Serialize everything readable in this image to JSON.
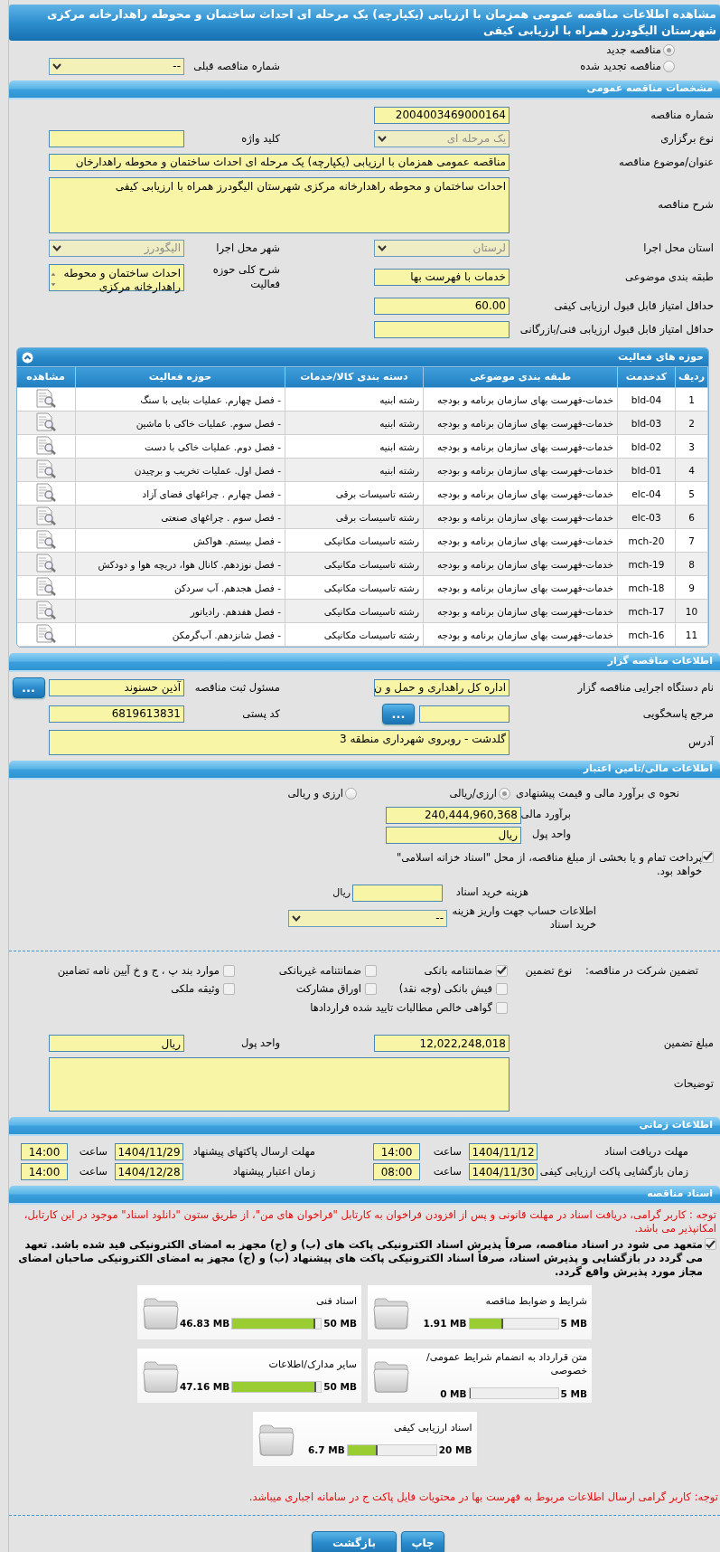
{
  "title": "مشاهده اطلاعات مناقصه عمومی همزمان با ارزیابی (یکپارچه) یک مرحله ای احداث ساختمان و محوطه راهدارخانه مرکزی شهرستان الیگودرز همراه با ارزیابی کیفی",
  "tender_kind": [
    {
      "label": "مناقصه جدید",
      "selected": true
    },
    {
      "label": "مناقصه تجدید شده",
      "selected": false
    }
  ],
  "previous_tender": {
    "label": "شماره مناقصه قبلی",
    "kind": "select",
    "value": "--",
    "disabled": false
  },
  "general": {
    "header": "مشخصات مناقصه عمومی",
    "rows": [
      [
        {
          "label": "شماره مناقصه",
          "kind": "text",
          "value": "2004003469000164"
        }
      ],
      [
        {
          "label": "نوع برگزاری",
          "kind": "select",
          "value": "یک مرحله ای",
          "disabled": true
        },
        {
          "label": "کلید واژه",
          "kind": "text"
        }
      ],
      [
        {
          "label": "عنوان/موضوع مناقصه",
          "kind": "line",
          "value": "مناقصه عمومی همزمان با ارزیابی (یکپارچه) یک مرحله ای احداث ساختمان و محوطه راهدارخان"
        }
      ],
      [
        {
          "label": "شرح مناقصه",
          "kind": "memo",
          "value": "احداث ساختمان و محوطه راهدارخانه مرکزی شهرستان الیگودرز همراه با ارزیابی کیفی"
        }
      ],
      [
        {
          "label": "استان محل اجرا",
          "kind": "select",
          "value": "لرستان",
          "disabled": true
        },
        {
          "label": "شهر محل اجرا",
          "kind": "select",
          "value": "الیگودرز",
          "disabled": true
        }
      ],
      [
        {
          "label": "طبقه بندی موضوعی",
          "kind": "text",
          "value": "خدمات با فهرست بها"
        },
        {
          "label": "شرح کلی حوزه فعالیت",
          "kind": "listbox",
          "value": "احداث ساختمان و محوطه راهدارخانه مرکزی"
        }
      ],
      [
        {
          "label": "حداقل امتیاز قابل قبول ارزیابی کیفی",
          "kind": "text",
          "value": "60.00"
        }
      ],
      [
        {
          "label": "حداقل امتیاز قابل قبول ارزیابی فنی/بازرگانی",
          "kind": "text"
        }
      ]
    ]
  },
  "activities": {
    "header": "حوزه های فعالیت",
    "columns": [
      "ردیف",
      "کدخدمت",
      "طبقه بندی موضوعی",
      "دسته بندی کالا/خدمات",
      "حوزه فعالیت",
      "مشاهده"
    ],
    "rows": [
      {
        "row": "1",
        "code": "bld-04",
        "classification": "خدمات-فهرست بهای سازمان برنامه و بودجه",
        "category": "رشته ابنیه",
        "activity": "- فصل چهارم. عملیات بنایی با سنگ"
      },
      {
        "row": "2",
        "code": "bld-03",
        "classification": "خدمات-فهرست بهای سازمان برنامه و بودجه",
        "category": "رشته ابنیه",
        "activity": "- فصل سوم. عملیات خاکی با ماشین"
      },
      {
        "row": "3",
        "code": "bld-02",
        "classification": "خدمات-فهرست بهای سازمان برنامه و بودجه",
        "category": "رشته ابنیه",
        "activity": "- فصل دوم. عملیات خاکی با دست"
      },
      {
        "row": "4",
        "code": "bld-01",
        "classification": "خدمات-فهرست بهای سازمان برنامه و بودجه",
        "category": "رشته ابنیه",
        "activity": "- فصل اول. عملیات تخریب و برچیدن"
      },
      {
        "row": "5",
        "code": "elc-04",
        "classification": "خدمات-فهرست بهای سازمان برنامه و بودجه",
        "category": "رشته تاسیسات برقی",
        "activity": "- فصل چهارم . چراغهای فضای آزاد"
      },
      {
        "row": "6",
        "code": "elc-03",
        "classification": "خدمات-فهرست بهای سازمان برنامه و بودجه",
        "category": "رشته تاسیسات برقی",
        "activity": "- فصل سوم . چراغهای صنعتی"
      },
      {
        "row": "7",
        "code": "mch-20",
        "classification": "خدمات-فهرست بهای سازمان برنامه و بودجه",
        "category": "رشته تاسیسات مکانیکی",
        "activity": "- فصل بیستم. هواکش"
      },
      {
        "row": "8",
        "code": "mch-19",
        "classification": "خدمات-فهرست بهای سازمان برنامه و بودجه",
        "category": "رشته تاسیسات مکانیکی",
        "activity": "- فصل نوزدهم. کانال هوا، دریچه هوا و دودکش"
      },
      {
        "row": "9",
        "code": "mch-18",
        "classification": "خدمات-فهرست بهای سازمان برنامه و بودجه",
        "category": "رشته تاسیسات مکانیکی",
        "activity": "- فصل هجدهم. آب سردکن"
      },
      {
        "row": "10",
        "code": "mch-17",
        "classification": "خدمات-فهرست بهای سازمان برنامه و بودجه",
        "category": "رشته تاسیسات مکانیکی",
        "activity": "- فصل هفدهم. رادیاتور"
      },
      {
        "row": "11",
        "code": "mch-16",
        "classification": "خدمات-فهرست بهای سازمان برنامه و بودجه",
        "category": "رشته تاسیسات مکانیکی",
        "activity": "- فصل شانزدهم. آب‌گرمکن"
      }
    ]
  },
  "issuer": {
    "header": "اطلاعات مناقصه گزار",
    "rows": [
      [
        {
          "label": "نام دستگاه اجرایی مناقصه گزار",
          "kind": "text",
          "value": "اداره کل راهداری و حمل و ن"
        },
        {
          "label": "مسئول ثبت مناقصه",
          "kind": "text",
          "value": "آذین حسنوند",
          "button": "..."
        }
      ],
      [
        {
          "label": "مرجع پاسخگویی",
          "kind": "text",
          "button": "..."
        },
        {
          "label": "کد پستی",
          "kind": "text",
          "value": "6819613831"
        }
      ],
      [
        {
          "label": "آدرس",
          "kind": "memo",
          "value": "گلدشت - روبروی شهرداری منطقه 3"
        }
      ]
    ]
  },
  "finance": {
    "header": "اطلاعات مالی/تامین اعتبار",
    "estimate_method": {
      "label": "نحوه ی برآورد مالی و قیمت پیشنهادی",
      "options": [
        {
          "label": "ارزی/ریالی",
          "selected": true
        },
        {
          "label": "ارزی و ریالی",
          "selected": false
        }
      ]
    },
    "fields": [
      {
        "label": "برآورد مالی",
        "value": "240,444,960,368"
      },
      {
        "label": "واحد پول",
        "value": "ریال"
      }
    ],
    "treasury": {
      "label": "پرداخت تمام و یا بخشی از مبلغ مناقصه، از محل \"اسناد خزانه اسلامی\" خواهد بود.",
      "checked": true
    },
    "document_fee": {
      "label": "هزینه خرید اسناد",
      "unit": "ریال"
    },
    "fee_account": {
      "label": "اطلاعات حساب جهت واریز هزینه خرید اسناد",
      "value": "--",
      "disabled": false
    }
  },
  "guarantee": {
    "label": "تضمین شرکت در مناقصه:",
    "type_label": "نوع تضمین",
    "types": [
      {
        "label": "ضمانتنامه بانکی",
        "checked": true
      },
      {
        "label": "ضمانتنامه غیربانکی",
        "checked": false
      },
      {
        "label": "موارد بند پ ، ج و خ آیین نامه تضامین",
        "checked": false
      },
      {
        "label": "فیش بانکی (وجه نقد)",
        "checked": false
      },
      {
        "label": "اوراق مشارکت",
        "checked": false
      },
      {
        "label": "وثیقه ملکی",
        "checked": false
      },
      {
        "label": "گواهی خالص مطالبات تایید شده قراردادها",
        "checked": false
      }
    ],
    "amount": {
      "label": "مبلغ تضمین",
      "value": "12,022,248,018"
    },
    "currency": {
      "label": "واحد پول",
      "value": "ریال"
    },
    "notes": {
      "label": "توضیحات"
    }
  },
  "timing": {
    "header": "اطلاعات زمانی",
    "rows": [
      [
        {
          "label": "مهلت دریافت اسناد",
          "date": "1404/11/12",
          "time_label": "ساعت",
          "time": "14:00"
        },
        {
          "label": "مهلت ارسال پاکتهای پیشنهاد",
          "date": "1404/11/29",
          "time_label": "ساعت",
          "time": "14:00"
        }
      ],
      [
        {
          "label": "زمان بازگشایی پاکت ارزیابی کیفی",
          "date": "1404/11/30",
          "time_label": "ساعت",
          "time": "08:00"
        },
        {
          "label": "زمان اعتبار پیشنهاد",
          "date": "1404/12/28",
          "time_label": "ساعت",
          "time": "14:00"
        }
      ]
    ]
  },
  "documents": {
    "header": "اسناد مناقصه",
    "notice": "توجه : کاربر گرامی، دریافت اسناد در مهلت قانونی و پس از افزودن فراخوان به کارتابل \"فراخوان های من\"، از طریق ستون \"دانلود اسناد\" موجود در این کارتابل، امکانپذیر می باشد.",
    "commitment": {
      "text": "متعهد می شود در اسناد مناقصه، صرفاً پذیرش اسناد الکترونیکی پاکت های (ب) و (ج) مجهز به امضای الکترونیکی قید شده باشد. تعهد می گردد در بازگشایی و پذیرش اسناد، صرفاً اسناد الکترونیکی پاکت های پیشنهاد (ب) و (ج) مجهز به امضای الکترونیکی صاحبان امضای مجاز مورد پذیرش واقع گردد.",
      "checked": true
    },
    "files": [
      {
        "title": "شرایط و ضوابط مناقصه",
        "max": "5 MB",
        "used": "1.91 MB",
        "level": 0.382
      },
      {
        "title": "اسناد فنی",
        "max": "50 MB",
        "used": "46.83 MB",
        "level": 0.937
      },
      {
        "title": "متن قرارداد به انضمام شرایط عمومی/خصوصی",
        "max": "5 MB",
        "used": "0 MB",
        "level": 0
      },
      {
        "title": "سایر مدارک/اطلاعات",
        "max": "50 MB",
        "used": "47.16 MB",
        "level": 0.943
      },
      {
        "title": "اسناد ارزیابی کیفی",
        "max": "20 MB",
        "used": "6.7 MB",
        "level": 0.335
      }
    ],
    "footnote": "توجه: کاربر گرامی ارسال اطلاعات مربوط به فهرست بها در محتویات فایل پاکت ج در سامانه اجباری میباشد."
  },
  "buttons": [
    {
      "label": "چاپ"
    },
    {
      "label": "بازگشت"
    }
  ]
}
